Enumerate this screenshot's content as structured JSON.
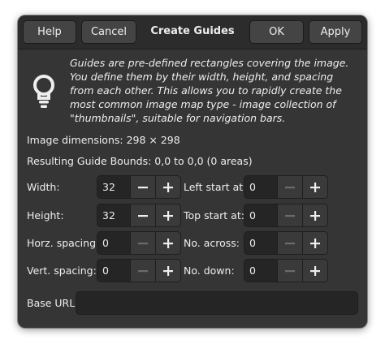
{
  "header": {
    "help_label": "Help",
    "cancel_label": "Cancel",
    "title": "Create Guides",
    "ok_label": "OK",
    "apply_label": "Apply"
  },
  "info": {
    "icon": "lightbulb-icon",
    "text": "Guides are pre-defined rectangles covering the image. You define them by their width, height, and spacing from each other. This allows you to rapidly create the most common image map type - image collection of \"thumbnails\", suitable for navigation bars."
  },
  "image_dimensions": "Image dimensions: 298 × 298",
  "guide_bounds": "Resulting Guide Bounds: 0,0 to 0,0 (0 areas)",
  "fields": {
    "width": {
      "label": "Width:",
      "value": "32"
    },
    "height": {
      "label": "Height:",
      "value": "32"
    },
    "horz_spacing": {
      "label": "Horz. spacing:",
      "value": "0"
    },
    "vert_spacing": {
      "label": "Vert. spacing:",
      "value": "0"
    },
    "left_start": {
      "label": "Left start at:",
      "value": "0"
    },
    "top_start": {
      "label": "Top start at:",
      "value": "0"
    },
    "no_across": {
      "label": "No. across:",
      "value": "0"
    },
    "no_down": {
      "label": "No. down:",
      "value": "0"
    }
  },
  "base_url": {
    "label": "Base URL:",
    "value": ""
  },
  "colors": {
    "dialog_bg": "#353535",
    "header_bg": "#2c2c2c",
    "entry_bg": "#252525",
    "text": "#eeeeec",
    "disabled_icon": "#6b6b6b"
  }
}
